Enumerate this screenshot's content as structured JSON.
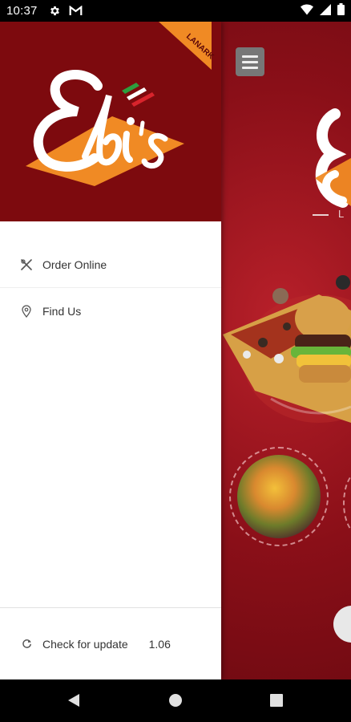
{
  "status_bar": {
    "time": "10:37",
    "icons": [
      "gear-icon",
      "gmail-icon",
      "wifi-icon",
      "signal-icon",
      "battery-icon"
    ]
  },
  "brand": {
    "logo_text": "Ebi's",
    "location_badge": "LANARK",
    "colors": {
      "header_bg": "#7d0a0e",
      "diamond": "#f08a24",
      "flag_green": "#2e9e3e",
      "flag_red": "#d8242c"
    }
  },
  "background": {
    "logo_letter": "E",
    "location_text": "L"
  },
  "drawer": {
    "items": [
      {
        "label": "Order Online",
        "icon": "utensils-icon"
      },
      {
        "label": "Find Us",
        "icon": "map-pin-icon"
      }
    ],
    "footer": {
      "label": "Check for update",
      "icon": "refresh-icon",
      "version": "1.06"
    }
  },
  "nav_bar": {
    "buttons": [
      "back-icon",
      "home-icon",
      "recents-icon"
    ]
  }
}
